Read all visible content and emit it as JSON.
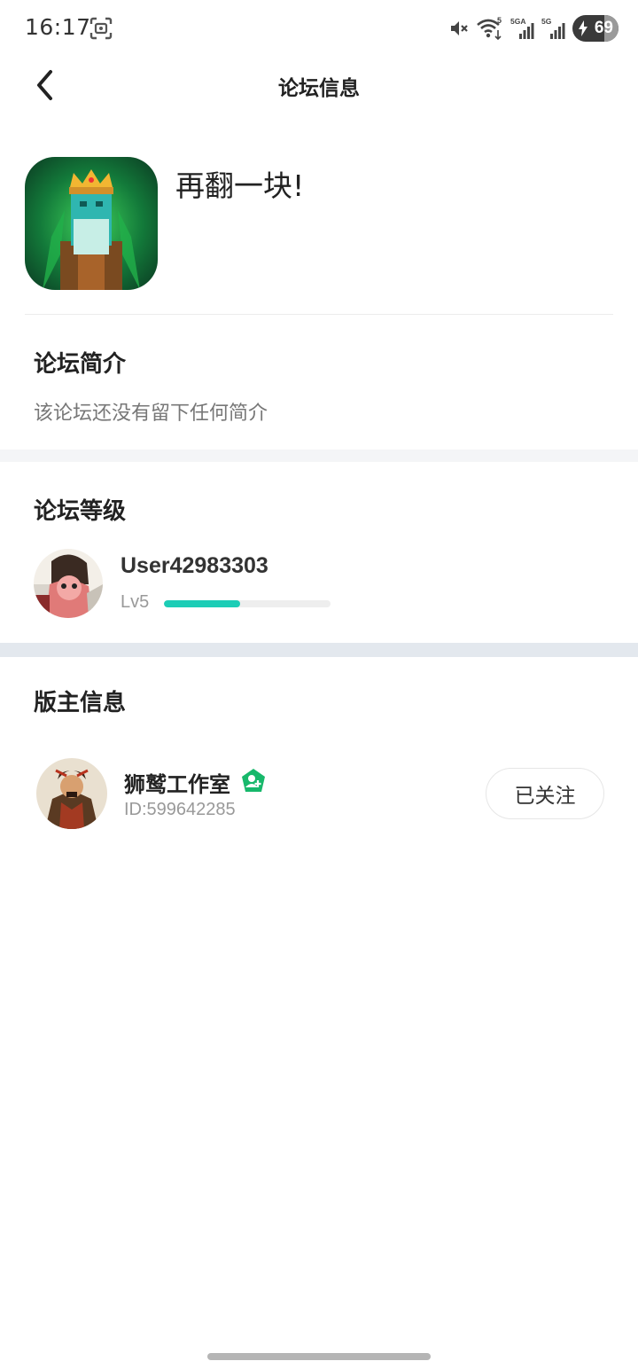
{
  "status_bar": {
    "time": "16:17",
    "battery_level": "69",
    "icons": [
      "screenshot-icon",
      "mute-icon",
      "wifi-icon",
      "signal-5ga-icon",
      "signal-5g-icon",
      "battery-charging-icon"
    ],
    "wifi_label": "5",
    "sim1_label": "5GA",
    "sim2_label": "5G"
  },
  "nav": {
    "title": "论坛信息",
    "back_icon": "chevron-left-icon"
  },
  "forum": {
    "name": "再翻一块!",
    "icon": "forum-game-icon"
  },
  "intro": {
    "title": "论坛简介",
    "text": "该论坛还没有留下任何简介"
  },
  "level": {
    "title": "论坛等级",
    "username": "User42983303",
    "lv": "Lv5",
    "progress": 0.46,
    "accent": "#1ccdb6"
  },
  "moderator": {
    "title": "版主信息",
    "name": "狮鹫工作室",
    "id": "ID:599642285",
    "badge_icon": "verified-badge-icon",
    "badge_color": "#17b86b",
    "follow_label": "已关注"
  }
}
